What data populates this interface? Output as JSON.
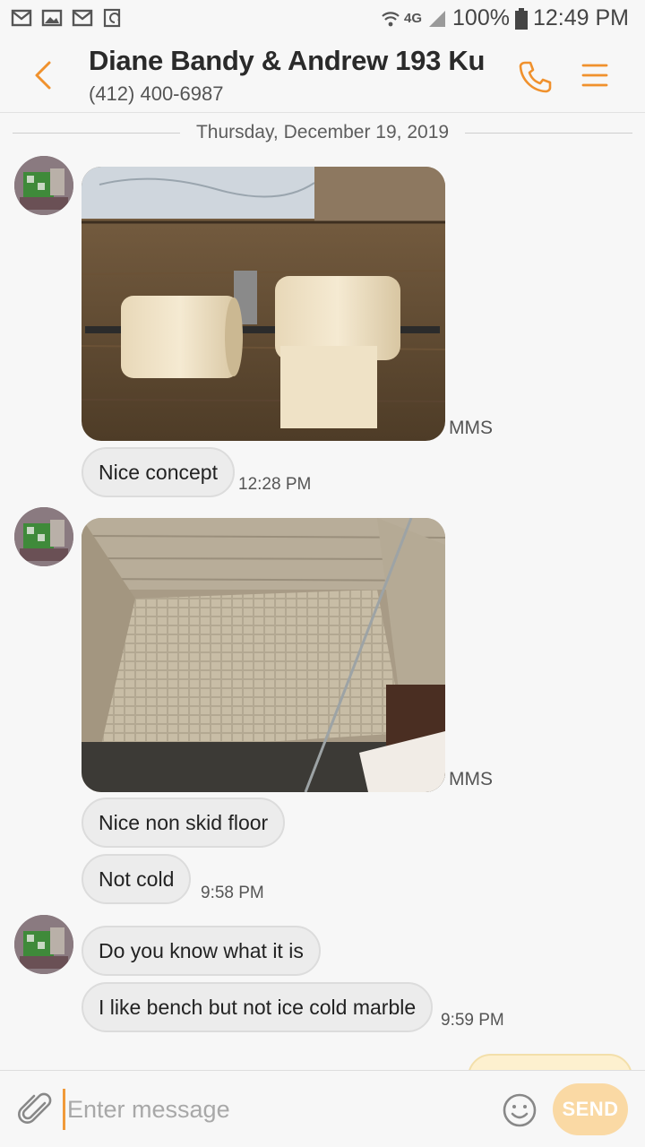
{
  "status_bar": {
    "network": "4G",
    "battery": "100%",
    "time": "12:49 PM"
  },
  "header": {
    "title": "Diane Bandy & Andrew 193 Ku",
    "phone": "(412) 400-6987"
  },
  "conversation": {
    "date": "Thursday, December 19, 2019",
    "mms_label": "MMS",
    "messages": [
      {
        "text": "Nice concept",
        "time": "12:28 PM"
      },
      {
        "text": "Nice non skid floor"
      },
      {
        "text": "Not cold",
        "time": "9:58 PM"
      },
      {
        "text": "Do you know what it is"
      },
      {
        "text": "I like bench but not ice cold marble",
        "time": "9:59 PM"
      }
    ]
  },
  "composer": {
    "placeholder": "Enter message",
    "send_label": "SEND"
  },
  "colors": {
    "accent": "#f0912d",
    "bubble": "#ececec",
    "send_disabled": "#fad9a4"
  }
}
